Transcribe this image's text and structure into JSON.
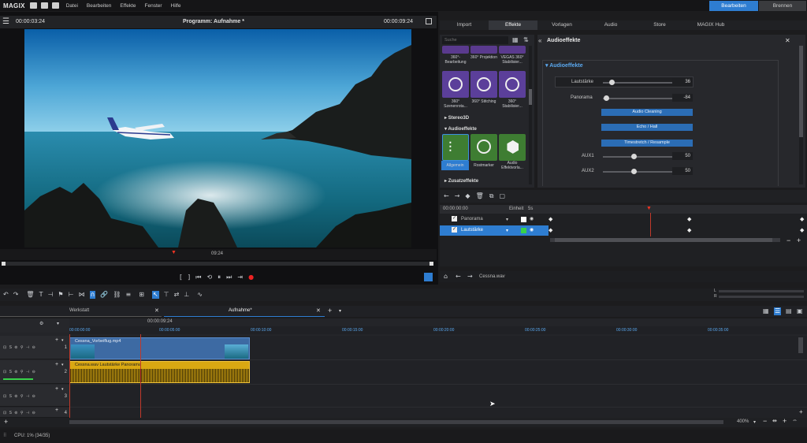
{
  "app": {
    "logo": "MAGIX"
  },
  "menu": [
    "Datei",
    "Bearbeiten",
    "Effekte",
    "Fenster",
    "Hilfe"
  ],
  "mode_buttons": {
    "edit": "Bearbeiten",
    "burn": "Brennen"
  },
  "preview": {
    "current_time": "00:00:03:24",
    "title": "Programm: Aufnahme *",
    "end_time": "00:00:09:24",
    "scrub_time": "09:24"
  },
  "right_tabs": [
    "Import",
    "Effekte",
    "Vorlagen",
    "Audio",
    "Store",
    "MAGIX Hub"
  ],
  "fx_list": {
    "search_placeholder": "Suche",
    "tiles_top": [
      {
        "label": "360°- Bearbeitung"
      },
      {
        "label": "360° Projektion"
      },
      {
        "label": "VEGAS 360° Stabilisier..."
      },
      {
        "label": "360° Szenenrota..."
      },
      {
        "label": "360° Stitching"
      },
      {
        "label": "360° Stabilisier..."
      }
    ],
    "category_stereo": "Stereo3D",
    "category_audio": "Audioeffekte",
    "audio_tiles": [
      {
        "label": "Allgemein"
      },
      {
        "label": "Rostmarker"
      },
      {
        "label": "Audio Effektvorla..."
      }
    ],
    "category_extra": "Zusatzeffekte"
  },
  "fx_detail": {
    "header": "Audioeffekte",
    "section": "Audioeffekte",
    "rows": [
      {
        "label": "Lautstärke",
        "value": "36",
        "level": 0.65
      },
      {
        "label": "Panorama",
        "value": "-84",
        "level": 0.08
      },
      {
        "label": "AUX1",
        "value": "50",
        "level": 0.5
      },
      {
        "label": "AUX2",
        "value": "50",
        "level": 0.5
      }
    ],
    "buttons": [
      "Audio Cleaning",
      "Echo / Hall",
      "Timestretch / Resample"
    ]
  },
  "keyframes": {
    "time": "00:00:00:00",
    "unit_label": "Einheit",
    "unit_value": "5s",
    "params": [
      {
        "label": "Panorama",
        "color": "#ffffff"
      },
      {
        "label": "Lautstärke",
        "color": "#38d24a"
      }
    ],
    "file": "Cessna.wav"
  },
  "timeline": {
    "tabs": [
      {
        "label": "Werkstatt"
      },
      {
        "label": "Aufnahme*"
      }
    ],
    "cursor_time": "00:00:09:24",
    "ruler": [
      "00:00:00:00",
      "00:00:05:00",
      "00:00:10:00",
      "00:00:15:00",
      "00:00:20:00",
      "00:00:25:00",
      "00:00:30:00",
      "00:00:35:00"
    ],
    "tracks": [
      "1",
      "2",
      "3",
      "4"
    ],
    "video_clip": "Cessna_Vorbeiflug.mp4",
    "audio_clip": "Cessna.wav  Lautstärke  Panorama",
    "zoom": "400%",
    "meter_labels": [
      "L",
      "R"
    ]
  },
  "status": {
    "cpu": "CPU:  1% (34/35)"
  }
}
